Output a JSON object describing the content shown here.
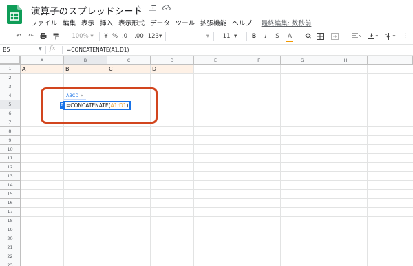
{
  "header": {
    "title": "演算子のスプレッドシート",
    "menu": [
      "ファイル",
      "編集",
      "表示",
      "挿入",
      "表示形式",
      "データ",
      "ツール",
      "拡張機能",
      "ヘルプ"
    ],
    "last_edit": "最終編集: 数秒前"
  },
  "toolbar": {
    "zoom": "100%",
    "percent": "%",
    "decimal_decrease": ".0",
    "decimal_increase": ".00",
    "more_formats": "123",
    "font_size": "11",
    "bold": "B",
    "italic": "I",
    "strike": "S",
    "text_color": "A"
  },
  "formula_bar": {
    "name_box": "B5",
    "fx": "fx",
    "formula": "=CONCATENATE(A1:D1)"
  },
  "grid": {
    "columns": [
      "A",
      "B",
      "C",
      "D",
      "E",
      "F",
      "G",
      "H",
      "I"
    ],
    "rows": [
      "1",
      "2",
      "3",
      "4",
      "5",
      "6",
      "7",
      "8",
      "9",
      "10",
      "11",
      "12",
      "13",
      "14",
      "15",
      "16",
      "17",
      "18",
      "19",
      "20",
      "21",
      "22",
      "23"
    ],
    "row1_values": [
      "A",
      "B",
      "C",
      "D"
    ]
  },
  "editor": {
    "preview": "ABCD",
    "preview_close": "×",
    "help_marker": "?",
    "formula_prefix": "=CONCATENATE(",
    "formula_ref": "A1:D1",
    "formula_suffix": ")"
  },
  "colors": {
    "sheets_green": "#0f9d58",
    "selection_blue": "#1a73e8",
    "annotation_red": "#d2451e",
    "range_fill": "#fef1e6",
    "range_border": "#f4b26b"
  }
}
